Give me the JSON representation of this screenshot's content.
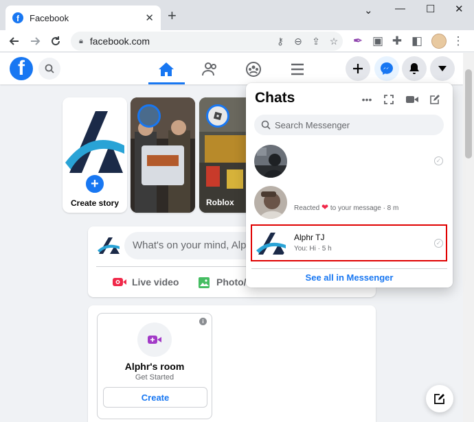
{
  "browser": {
    "tab_title": "Facebook",
    "url": "facebook.com",
    "tab_favicon_letter": "f"
  },
  "fb_header": {
    "logo_letter": "f"
  },
  "stories": [
    {
      "label": "Create story",
      "type": "create"
    },
    {
      "label": "",
      "type": "photo"
    },
    {
      "label": "Roblox",
      "type": "photo"
    }
  ],
  "composer": {
    "placeholder": "What's on your mind, Alph",
    "actions": [
      {
        "label": "Live video",
        "icon": "live-video-icon",
        "color": "#f02849"
      },
      {
        "label": "Photo/v",
        "icon": "photo-icon",
        "color": "#45bd62"
      }
    ]
  },
  "room": {
    "title": "Alphr's room",
    "subtitle": "Get Started",
    "button": "Create",
    "info": "i"
  },
  "chats": {
    "title": "Chats",
    "search_placeholder": "Search Messenger",
    "conversations": [
      {
        "name": "",
        "preview": "",
        "highlighted": false
      },
      {
        "name": "",
        "preview_before": "Reacted ",
        "reaction": "❤",
        "preview_after": " to your message · 8 m",
        "highlighted": false
      },
      {
        "name": "Alphr TJ",
        "preview": "You: Hi · 5 h",
        "highlighted": true
      }
    ],
    "see_all": "See all in Messenger"
  },
  "colors": {
    "facebook_blue": "#1877f2",
    "highlight_red": "#e00000",
    "reaction_heart": "#f02849"
  }
}
